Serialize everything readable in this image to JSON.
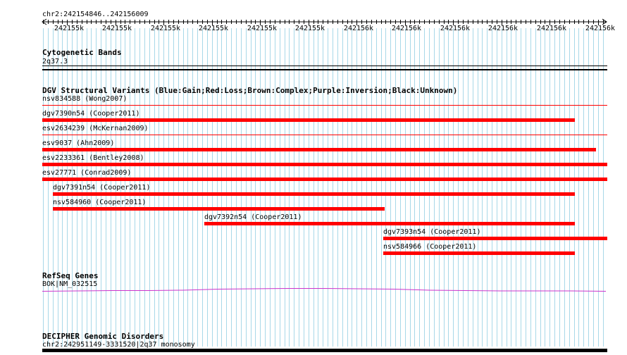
{
  "ruler": {
    "coords": "chr2:242154846..242156009",
    "ticks": [
      "242155k",
      "242155k",
      "242155k",
      "242155k",
      "242155k",
      "242155k",
      "242156k",
      "242156k",
      "242156k",
      "242156k",
      "242156k",
      "242156k"
    ]
  },
  "cytoband": {
    "title": "Cytogenetic Bands",
    "label": "2q37.3"
  },
  "dgv": {
    "title": "DGV Structural Variants (Blue:Gain;Red:Loss;Brown:Complex;Purple:Inversion;Black:Unknown)",
    "features": [
      {
        "label": "nsv834588 (Wong2007)"
      },
      {
        "label": "dgv7390n54 (Cooper2011)"
      },
      {
        "label": "esv2634239 (McKernan2009)"
      },
      {
        "label": "esv9037 (Ahn2009)"
      },
      {
        "label": "esv2233361 (Bentley2008)"
      },
      {
        "label": "esv27771 (Conrad2009)"
      },
      {
        "label": "dgv7391n54 (Cooper2011)"
      },
      {
        "label": "nsv584960 (Cooper2011)"
      },
      {
        "label": "dgv7392n54 (Cooper2011)"
      },
      {
        "label": "dgv7393n54 (Cooper2011)"
      },
      {
        "label": "nsv584966 (Cooper2011)"
      }
    ]
  },
  "refseq": {
    "title": "RefSeq Genes",
    "label": "BOK|NM_032515"
  },
  "decipher": {
    "title": "DECIPHER Genomic Disorders",
    "label": "chr2:242951149-3331520|2q37 monosomy"
  },
  "colors": {
    "loss": "#ff0000",
    "gene": "#cc33cc",
    "grid": "#a8d8e8"
  }
}
